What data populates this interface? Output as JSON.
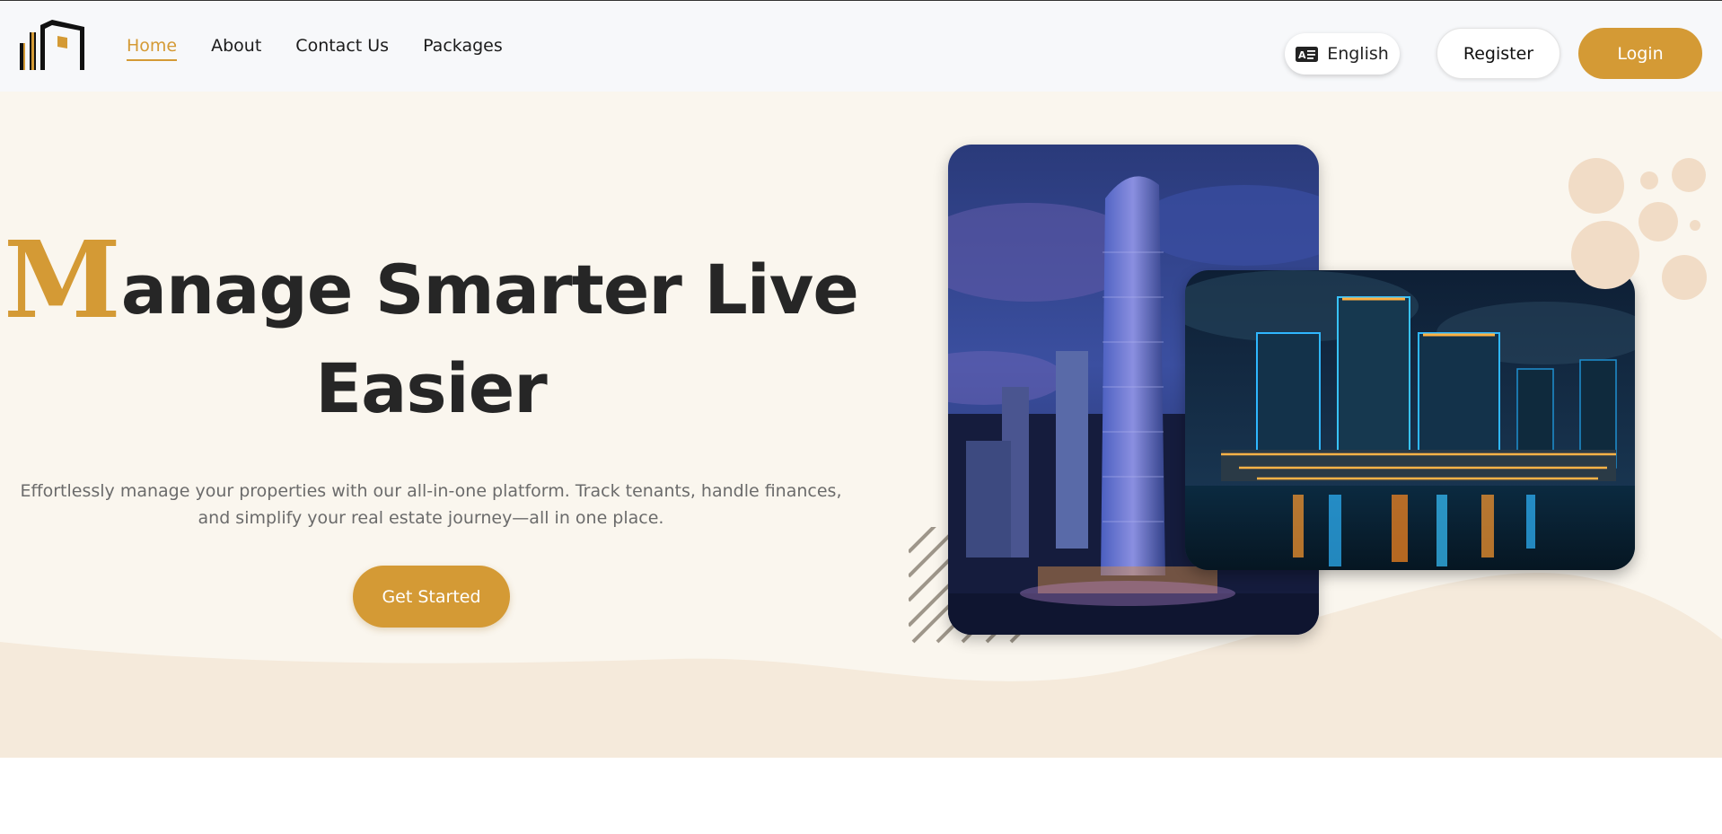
{
  "nav": {
    "links": [
      {
        "label": "Home",
        "active": true
      },
      {
        "label": "About",
        "active": false
      },
      {
        "label": "Contact Us",
        "active": false
      },
      {
        "label": "Packages",
        "active": false
      }
    ],
    "language_label": "English",
    "language_icon": "language-translate-icon",
    "register_label": "Register",
    "login_label": "Login"
  },
  "hero": {
    "heading_initial": "M",
    "heading_rest_line1": "anage Smarter Live",
    "heading_line2": "Easier",
    "subtitle": "Effortlessly manage your properties with our all-in-one platform. Track tenants, handle finances, and simplify your real estate journey—all in one place.",
    "cta_label": "Get Started"
  },
  "colors": {
    "accent": "#d49a35",
    "heading": "#262626",
    "hero_bg": "#faf6ee",
    "wave": "#f5eadb"
  }
}
